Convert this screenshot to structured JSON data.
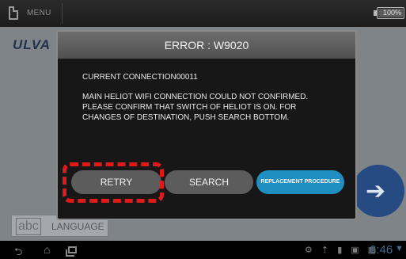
{
  "topbar": {
    "menu_label": "MENU",
    "battery_label": "100%",
    "battery_level": 1.0
  },
  "app": {
    "logo_text": "ULVA",
    "language": {
      "abc": "abc",
      "label": "LANGUAGE"
    }
  },
  "dialog": {
    "title": "ERROR : W9020",
    "connection": "CURRENT CONNECTION00011",
    "message_lines": [
      "MAIN HELIOT WIFI CONNECTION COULD NOT CONFIRMED.",
      "PLEASE CONFIRM THAT SWITCH OF HELIOT IS ON. FOR",
      "CHANGES OF DESTINATION, PUSH SEARCH BOTTOM."
    ],
    "buttons": {
      "retry": "RETRY",
      "search": "SEARCH",
      "replacement": "REPLACEMENT PROCEDURE"
    }
  },
  "systembar": {
    "time": "6:46"
  },
  "colors": {
    "accent_blue": "#1f8fc2",
    "highlight_red": "#e01a1a",
    "dialog_bg": "#171717"
  }
}
